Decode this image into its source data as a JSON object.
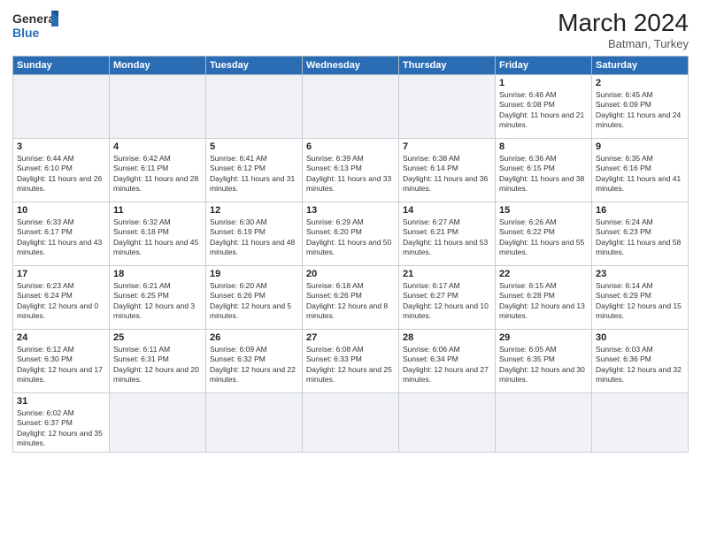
{
  "header": {
    "logo_general": "General",
    "logo_blue": "Blue",
    "month_title": "March 2024",
    "subtitle": "Batman, Turkey"
  },
  "weekdays": [
    "Sunday",
    "Monday",
    "Tuesday",
    "Wednesday",
    "Thursday",
    "Friday",
    "Saturday"
  ],
  "weeks": [
    [
      {
        "day": "",
        "info": ""
      },
      {
        "day": "",
        "info": ""
      },
      {
        "day": "",
        "info": ""
      },
      {
        "day": "",
        "info": ""
      },
      {
        "day": "",
        "info": ""
      },
      {
        "day": "1",
        "info": "Sunrise: 6:46 AM\nSunset: 6:08 PM\nDaylight: 11 hours and 21 minutes."
      },
      {
        "day": "2",
        "info": "Sunrise: 6:45 AM\nSunset: 6:09 PM\nDaylight: 11 hours and 24 minutes."
      }
    ],
    [
      {
        "day": "3",
        "info": "Sunrise: 6:44 AM\nSunset: 6:10 PM\nDaylight: 11 hours and 26 minutes."
      },
      {
        "day": "4",
        "info": "Sunrise: 6:42 AM\nSunset: 6:11 PM\nDaylight: 11 hours and 28 minutes."
      },
      {
        "day": "5",
        "info": "Sunrise: 6:41 AM\nSunset: 6:12 PM\nDaylight: 11 hours and 31 minutes."
      },
      {
        "day": "6",
        "info": "Sunrise: 6:39 AM\nSunset: 6:13 PM\nDaylight: 11 hours and 33 minutes."
      },
      {
        "day": "7",
        "info": "Sunrise: 6:38 AM\nSunset: 6:14 PM\nDaylight: 11 hours and 36 minutes."
      },
      {
        "day": "8",
        "info": "Sunrise: 6:36 AM\nSunset: 6:15 PM\nDaylight: 11 hours and 38 minutes."
      },
      {
        "day": "9",
        "info": "Sunrise: 6:35 AM\nSunset: 6:16 PM\nDaylight: 11 hours and 41 minutes."
      }
    ],
    [
      {
        "day": "10",
        "info": "Sunrise: 6:33 AM\nSunset: 6:17 PM\nDaylight: 11 hours and 43 minutes."
      },
      {
        "day": "11",
        "info": "Sunrise: 6:32 AM\nSunset: 6:18 PM\nDaylight: 11 hours and 45 minutes."
      },
      {
        "day": "12",
        "info": "Sunrise: 6:30 AM\nSunset: 6:19 PM\nDaylight: 11 hours and 48 minutes."
      },
      {
        "day": "13",
        "info": "Sunrise: 6:29 AM\nSunset: 6:20 PM\nDaylight: 11 hours and 50 minutes."
      },
      {
        "day": "14",
        "info": "Sunrise: 6:27 AM\nSunset: 6:21 PM\nDaylight: 11 hours and 53 minutes."
      },
      {
        "day": "15",
        "info": "Sunrise: 6:26 AM\nSunset: 6:22 PM\nDaylight: 11 hours and 55 minutes."
      },
      {
        "day": "16",
        "info": "Sunrise: 6:24 AM\nSunset: 6:23 PM\nDaylight: 11 hours and 58 minutes."
      }
    ],
    [
      {
        "day": "17",
        "info": "Sunrise: 6:23 AM\nSunset: 6:24 PM\nDaylight: 12 hours and 0 minutes."
      },
      {
        "day": "18",
        "info": "Sunrise: 6:21 AM\nSunset: 6:25 PM\nDaylight: 12 hours and 3 minutes."
      },
      {
        "day": "19",
        "info": "Sunrise: 6:20 AM\nSunset: 6:26 PM\nDaylight: 12 hours and 5 minutes."
      },
      {
        "day": "20",
        "info": "Sunrise: 6:18 AM\nSunset: 6:26 PM\nDaylight: 12 hours and 8 minutes."
      },
      {
        "day": "21",
        "info": "Sunrise: 6:17 AM\nSunset: 6:27 PM\nDaylight: 12 hours and 10 minutes."
      },
      {
        "day": "22",
        "info": "Sunrise: 6:15 AM\nSunset: 6:28 PM\nDaylight: 12 hours and 13 minutes."
      },
      {
        "day": "23",
        "info": "Sunrise: 6:14 AM\nSunset: 6:29 PM\nDaylight: 12 hours and 15 minutes."
      }
    ],
    [
      {
        "day": "24",
        "info": "Sunrise: 6:12 AM\nSunset: 6:30 PM\nDaylight: 12 hours and 17 minutes."
      },
      {
        "day": "25",
        "info": "Sunrise: 6:11 AM\nSunset: 6:31 PM\nDaylight: 12 hours and 20 minutes."
      },
      {
        "day": "26",
        "info": "Sunrise: 6:09 AM\nSunset: 6:32 PM\nDaylight: 12 hours and 22 minutes."
      },
      {
        "day": "27",
        "info": "Sunrise: 6:08 AM\nSunset: 6:33 PM\nDaylight: 12 hours and 25 minutes."
      },
      {
        "day": "28",
        "info": "Sunrise: 6:06 AM\nSunset: 6:34 PM\nDaylight: 12 hours and 27 minutes."
      },
      {
        "day": "29",
        "info": "Sunrise: 6:05 AM\nSunset: 6:35 PM\nDaylight: 12 hours and 30 minutes."
      },
      {
        "day": "30",
        "info": "Sunrise: 6:03 AM\nSunset: 6:36 PM\nDaylight: 12 hours and 32 minutes."
      }
    ],
    [
      {
        "day": "31",
        "info": "Sunrise: 6:02 AM\nSunset: 6:37 PM\nDaylight: 12 hours and 35 minutes."
      },
      {
        "day": "",
        "info": ""
      },
      {
        "day": "",
        "info": ""
      },
      {
        "day": "",
        "info": ""
      },
      {
        "day": "",
        "info": ""
      },
      {
        "day": "",
        "info": ""
      },
      {
        "day": "",
        "info": ""
      }
    ]
  ]
}
